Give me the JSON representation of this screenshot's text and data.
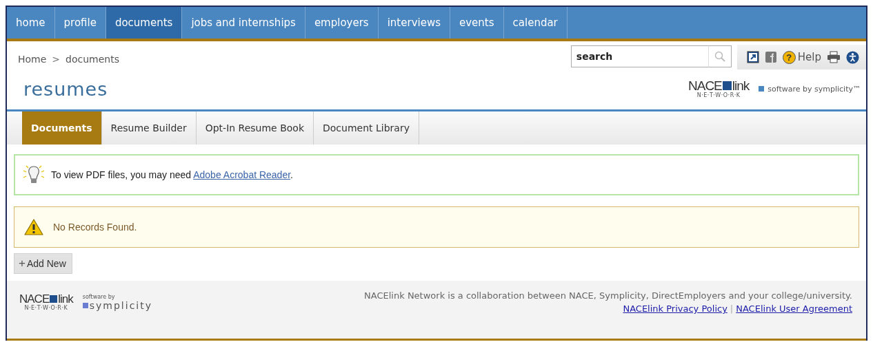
{
  "nav": [
    {
      "label": "home",
      "selected": false
    },
    {
      "label": "profile",
      "selected": false
    },
    {
      "label": "documents",
      "selected": true
    },
    {
      "label": "jobs and internships",
      "selected": false
    },
    {
      "label": "employers",
      "selected": false
    },
    {
      "label": "interviews",
      "selected": false
    },
    {
      "label": "events",
      "selected": false
    },
    {
      "label": "calendar",
      "selected": false
    }
  ],
  "breadcrumb": {
    "items": [
      "Home",
      "documents"
    ],
    "separator": ">"
  },
  "search": {
    "placeholder": "search"
  },
  "help_icon": "?",
  "help_label": "Help",
  "page_title": "resumes",
  "brand": {
    "name_a": "NACE",
    "name_b": "link",
    "network": "N·E·T·W·O·R·K",
    "vendor": "software by symplicity™"
  },
  "subtabs": [
    {
      "label": "Documents",
      "selected": true
    },
    {
      "label": "Resume Builder",
      "selected": false
    },
    {
      "label": "Opt-In Resume Book",
      "selected": false
    },
    {
      "label": "Document Library",
      "selected": false
    }
  ],
  "notices": [
    {
      "kind": "tip",
      "text": "To view PDF files, you may need ",
      "link": "Adobe Acrobat Reader",
      "after": "."
    },
    {
      "kind": "warning",
      "text": "No Records Found."
    }
  ],
  "add_button": {
    "icon": "+",
    "label": "Add New"
  },
  "footer": {
    "name_a": "NACE",
    "name_b": "link",
    "network": "N·E·T·W·O·R·K",
    "vendor_small": "software by",
    "vendor_name": "symplicity",
    "note": "NACElink Network is a collaboration between NACE, Symplicity, DirectEmployers and your college/university.",
    "links": [
      "NACElink Privacy Policy",
      "NACElink User Agreement"
    ],
    "separator": "|"
  }
}
